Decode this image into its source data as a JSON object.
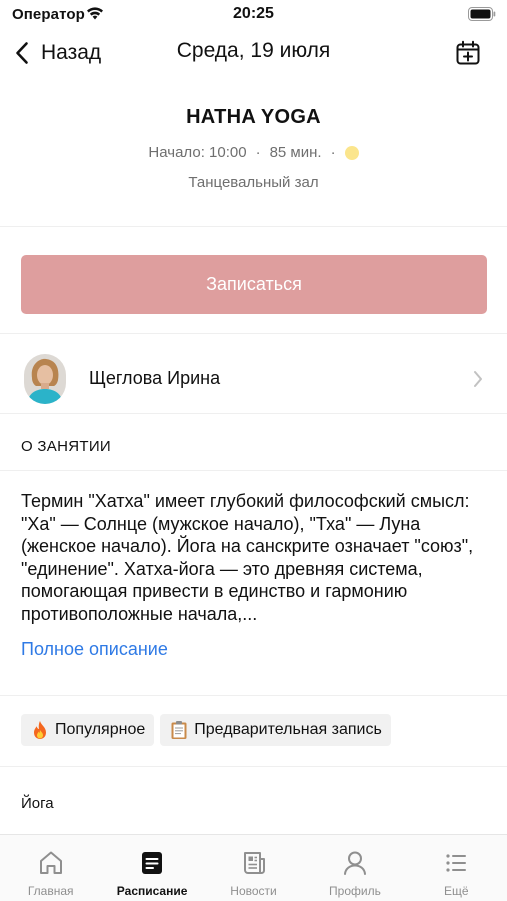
{
  "status_bar": {
    "carrier": "Оператор",
    "time": "20:25",
    "wifi_icon": "wifi-icon",
    "battery_icon": "battery-icon"
  },
  "nav": {
    "back_label": "Назад",
    "title": "Среда, 19 июля",
    "calendar_icon": "calendar-add-icon"
  },
  "class": {
    "title": "HATHA YOGA",
    "start": "Начало: 10:00",
    "separator": "·",
    "duration": "85 мин.",
    "status_color": "#fbe58c",
    "location": "Танцевальный зал"
  },
  "signup": {
    "label": "Записаться",
    "color": "#de9e9e"
  },
  "trainer": {
    "name": "Щеглова Ирина"
  },
  "about": {
    "section_title": "О ЗАНЯТИИ",
    "description": "Термин \"Хатха\" имеет глубокий философский смысл: \"Ха\" — Солнце (мужское начало), \"Тха\" — Луна (женское начало). Йога на санскрите означает \"союз\", \"единение\". Хатха-йога — это древняя система, помогающая привести в единство и гармонию противоположные начала,...",
    "full_link": "Полное описание",
    "link_color": "#2f7ae5"
  },
  "tags": [
    {
      "icon": "fire-icon",
      "label": "Популярное"
    },
    {
      "icon": "clipboard-icon",
      "label": "Предварительная запись"
    }
  ],
  "category": "Йога",
  "tabbar": {
    "active": "Расписание",
    "items": [
      {
        "icon": "home-icon",
        "label": "Главная"
      },
      {
        "icon": "schedule-icon",
        "label": "Расписание"
      },
      {
        "icon": "news-icon",
        "label": "Новости"
      },
      {
        "icon": "profile-icon",
        "label": "Профиль"
      },
      {
        "icon": "more-icon",
        "label": "Ещё"
      }
    ]
  }
}
